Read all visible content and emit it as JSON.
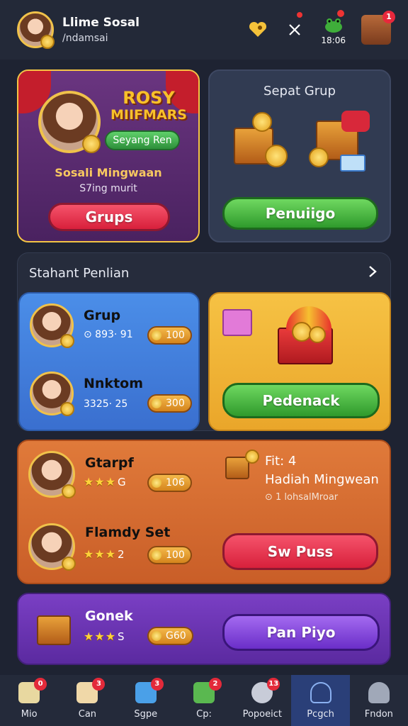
{
  "header": {
    "name": "Llime Sosal",
    "subtitle": "/ndamsai",
    "time": "18:06",
    "notif_badge": "1"
  },
  "promo": {
    "logo_line1": "ROSY",
    "logo_line2": "MIIFMARS",
    "pill": "Seyang Ren",
    "title": "Sosali Mingwaan",
    "desc": "S7ing murit",
    "button": "Grups"
  },
  "group_card": {
    "title": "Sepat Grup",
    "button": "Penuiigo"
  },
  "section": {
    "title": "Stahant Penlian"
  },
  "blue_rows": [
    {
      "name": "Grup",
      "meta": "⊙ 893· 91",
      "chip": "100"
    },
    {
      "name": "Nnktom",
      "meta": "3325· 25",
      "chip": "300"
    }
  ],
  "yellow_card": {
    "button": "Pedenack"
  },
  "orange_rows": [
    {
      "name": "Gtarpf",
      "stars": "★★★",
      "star_num": "G",
      "chip": "106"
    },
    {
      "name": "Flamdy Set",
      "stars": "★★★",
      "star_num": "2",
      "chip": "100"
    }
  ],
  "orange_info": {
    "fit": "Fit: 4",
    "hadiah": "Hadiah Mingwean",
    "sub": "⊙ 1 lohsalMroar",
    "button": "Sw Puss"
  },
  "purple_card": {
    "name": "Gonek",
    "stars": "★★★",
    "star_num": "S",
    "chip": "G60",
    "button": "Pan Piyo"
  },
  "nav": [
    {
      "label": "Mio",
      "badge": "0",
      "icon": "map-icon",
      "color": "#e8d8a0"
    },
    {
      "label": "Can",
      "badge": "3",
      "icon": "cards-icon",
      "color": "#f0d8a8"
    },
    {
      "label": "Sgpe",
      "badge": "3",
      "icon": "puzzle-icon",
      "color": "#4aa0e8"
    },
    {
      "label": "Cp:",
      "badge": "2",
      "icon": "leaf-icon",
      "color": "#5ab850"
    },
    {
      "label": "Popoeict",
      "badge": "13",
      "icon": "shell-icon",
      "color": "#c8ccd8"
    },
    {
      "label": "Pcgch",
      "badge": "",
      "icon": "user-outline-icon",
      "color": "#8ab0f0"
    },
    {
      "label": "Fndon",
      "badge": "",
      "icon": "user-icon",
      "color": "#a0a8b8"
    }
  ]
}
